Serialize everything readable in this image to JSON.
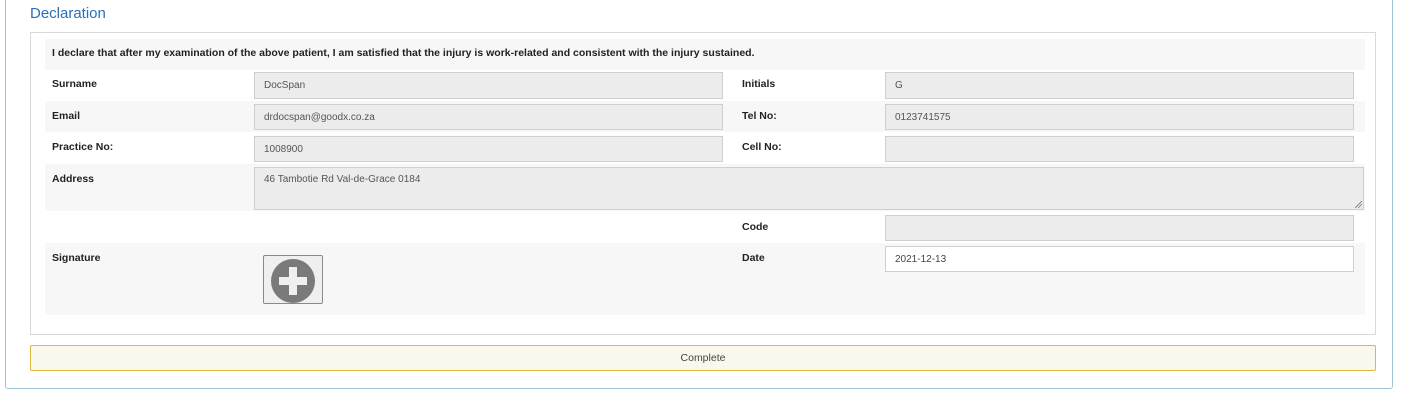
{
  "panel": {
    "title": "Declaration"
  },
  "declaration": {
    "statement": "I declare that after my examination of the above patient, I am satisfied that the injury is work-related and consistent with the injury sustained."
  },
  "fields": {
    "surname": {
      "label": "Surname",
      "value": "DocSpan"
    },
    "initials": {
      "label": "Initials",
      "value": "G"
    },
    "email": {
      "label": "Email",
      "value": "drdocspan@goodx.co.za"
    },
    "tel_no": {
      "label": "Tel No:",
      "value": "0123741575"
    },
    "practice_no": {
      "label": "Practice No:",
      "value": "1008900"
    },
    "cell_no": {
      "label": "Cell No:",
      "value": ""
    },
    "address": {
      "label": "Address",
      "value": "46 Tambotie Rd Val-de-Grace 0184"
    },
    "code": {
      "label": "Code",
      "value": ""
    },
    "signature": {
      "label": "Signature",
      "icon": "plus-circle-icon"
    },
    "date": {
      "label": "Date",
      "value": "2021-12-13"
    }
  },
  "actions": {
    "complete_label": "Complete"
  },
  "colors": {
    "title": "#2a6ebb",
    "panel_border": "#9fc2d4",
    "complete_border": "#e0b93a",
    "field_bg": "#ececec"
  }
}
